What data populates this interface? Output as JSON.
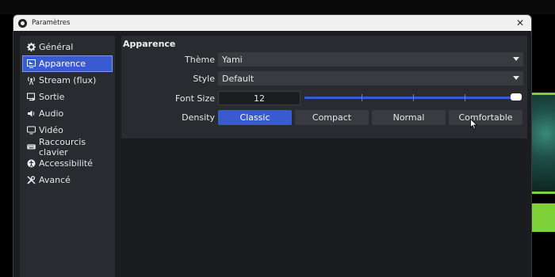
{
  "window": {
    "title": "Paramètres",
    "close_label": "✕"
  },
  "sidebar": {
    "items": [
      {
        "label": "Général",
        "icon": "gear-icon"
      },
      {
        "label": "Apparence",
        "icon": "appearance-icon",
        "active": true
      },
      {
        "label": "Stream (flux)",
        "icon": "antenna-icon"
      },
      {
        "label": "Sortie",
        "icon": "output-icon"
      },
      {
        "label": "Audio",
        "icon": "speaker-icon"
      },
      {
        "label": "Vidéo",
        "icon": "monitor-icon"
      },
      {
        "label": "Raccourcis clavier",
        "icon": "keyboard-icon"
      },
      {
        "label": "Accessibilité",
        "icon": "accessibility-icon"
      },
      {
        "label": "Avancé",
        "icon": "tools-icon"
      }
    ]
  },
  "appearance": {
    "section_title": "Apparence",
    "theme_label": "Thème",
    "theme_value": "Yami",
    "style_label": "Style",
    "style_value": "Default",
    "font_size_label": "Font Size",
    "font_size_value": "12",
    "font_size_slider_fraction": 1.0,
    "density_label": "Density",
    "density_options": [
      "Classic",
      "Compact",
      "Normal",
      "Comfortable"
    ],
    "density_selected": "Classic"
  },
  "colors": {
    "accent": "#3a5ad1",
    "panel": "#2a2b30",
    "background": "#1b1c20"
  }
}
